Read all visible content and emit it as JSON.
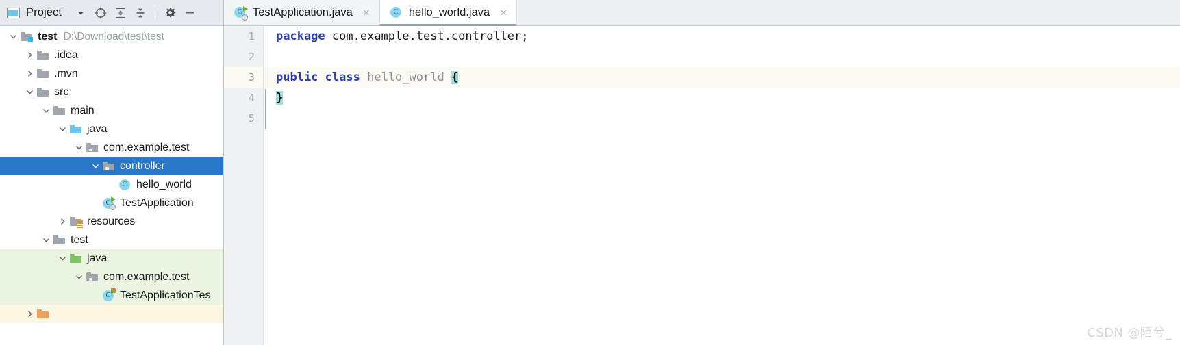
{
  "project_panel": {
    "title": "Project",
    "icons": {
      "window": "project-window-icon",
      "dropdown": "chevron-down-icon",
      "locate": "locate-target-icon",
      "expand_all": "expand-all-icon",
      "collapse_all": "collapse-all-icon",
      "settings": "gear-icon",
      "minimize": "minimize-icon"
    },
    "tree": [
      {
        "label": "test",
        "detail": "D:\\Download\\test\\test",
        "icon": "module-root-folder",
        "indent": 0,
        "arrow": "expanded",
        "bold": true,
        "bg": "none"
      },
      {
        "label": ".idea",
        "detail": "",
        "icon": "gray-folder",
        "indent": 1,
        "arrow": "collapsed",
        "bold": false,
        "bg": "none"
      },
      {
        "label": ".mvn",
        "detail": "",
        "icon": "gray-folder",
        "indent": 1,
        "arrow": "collapsed",
        "bold": false,
        "bg": "none"
      },
      {
        "label": "src",
        "detail": "",
        "icon": "gray-folder",
        "indent": 1,
        "arrow": "expanded",
        "bold": false,
        "bg": "none"
      },
      {
        "label": "main",
        "detail": "",
        "icon": "gray-folder",
        "indent": 2,
        "arrow": "expanded",
        "bold": false,
        "bg": "none"
      },
      {
        "label": "java",
        "detail": "",
        "icon": "blue-source-folder",
        "indent": 3,
        "arrow": "expanded",
        "bold": false,
        "bg": "none"
      },
      {
        "label": "com.example.test",
        "detail": "",
        "icon": "package-folder",
        "indent": 4,
        "arrow": "expanded",
        "bold": false,
        "bg": "none"
      },
      {
        "label": "controller",
        "detail": "",
        "icon": "package-folder",
        "indent": 5,
        "arrow": "expanded",
        "bold": false,
        "bg": "selected"
      },
      {
        "label": "hello_world",
        "detail": "",
        "icon": "java-class",
        "indent": 6,
        "arrow": "none",
        "bold": false,
        "bg": "none"
      },
      {
        "label": "TestApplication",
        "detail": "",
        "icon": "spring-boot-class",
        "indent": 5,
        "arrow": "none",
        "bold": false,
        "bg": "none"
      },
      {
        "label": "resources",
        "detail": "",
        "icon": "resources-folder",
        "indent": 3,
        "arrow": "collapsed",
        "bold": false,
        "bg": "none"
      },
      {
        "label": "test",
        "detail": "",
        "icon": "gray-folder",
        "indent": 2,
        "arrow": "expanded",
        "bold": false,
        "bg": "none"
      },
      {
        "label": "java",
        "detail": "",
        "icon": "green-test-folder",
        "indent": 3,
        "arrow": "expanded",
        "bold": false,
        "bg": "test"
      },
      {
        "label": "com.example.test",
        "detail": "",
        "icon": "package-folder",
        "indent": 4,
        "arrow": "expanded",
        "bold": false,
        "bg": "test"
      },
      {
        "label": "TestApplicationTes",
        "detail": "",
        "icon": "test-class",
        "indent": 5,
        "arrow": "none",
        "bold": false,
        "bg": "test"
      }
    ]
  },
  "editor": {
    "tabs": [
      {
        "label": "TestApplication.java",
        "icon": "spring-boot-class",
        "active": false,
        "close": "×"
      },
      {
        "label": "hello_world.java",
        "icon": "java-class",
        "active": true,
        "close": "×"
      }
    ],
    "line_numbers": [
      "1",
      "2",
      "3",
      "4",
      "5"
    ],
    "code_lines": [
      {
        "n": "1",
        "current": false,
        "tokens": [
          {
            "t": "package",
            "c": "kw"
          },
          {
            "t": " ",
            "c": "plain"
          },
          {
            "t": "com.example.test.controller;",
            "c": "plain"
          }
        ]
      },
      {
        "n": "2",
        "current": false,
        "tokens": []
      },
      {
        "n": "3",
        "current": true,
        "tokens": [
          {
            "t": "public",
            "c": "kw"
          },
          {
            "t": " ",
            "c": "plain"
          },
          {
            "t": "class",
            "c": "kw"
          },
          {
            "t": " ",
            "c": "plain"
          },
          {
            "t": "hello_world",
            "c": "ident"
          },
          {
            "t": " ",
            "c": "plain"
          },
          {
            "t": "{",
            "c": "brace-hl"
          }
        ]
      },
      {
        "n": "4",
        "current": false,
        "tokens": [
          {
            "t": "}",
            "c": "brace-hl"
          }
        ]
      },
      {
        "n": "5",
        "current": false,
        "tokens": []
      }
    ]
  },
  "watermark": {
    "text": "CSDN @陌兮_"
  },
  "colors": {
    "selection_blue": "#2a76c8",
    "test_source_bg": "#e9f5e1",
    "resources_bg": "#fdf6e3",
    "current_line_bg": "#fcfbf3",
    "brace_match": "#9fe0dc",
    "keyword": "#2e3fa8",
    "toolbar_bg": "#e6e9ef",
    "tab_active_underline": "#9ba7bb"
  }
}
